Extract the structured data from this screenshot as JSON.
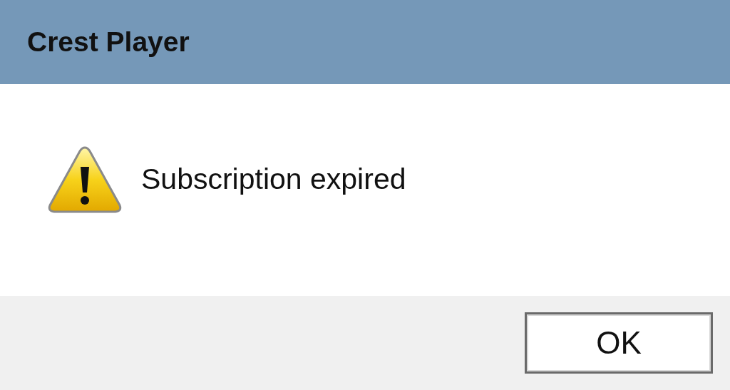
{
  "window": {
    "title": "Crest Player"
  },
  "message": {
    "text": "Subscription expired"
  },
  "buttons": [
    {
      "label": "OK"
    }
  ]
}
